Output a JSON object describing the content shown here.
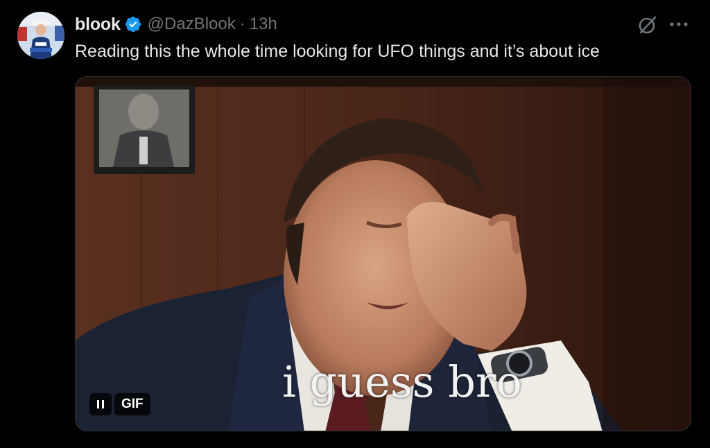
{
  "tweet": {
    "author_name": "blook",
    "handle": "@DazBlook",
    "separator": "·",
    "time": "13h",
    "text": "Reading this the whole time looking for UFO things and it’s about ice"
  },
  "media": {
    "caption": "i guess bro",
    "gif_label": "GIF"
  },
  "icons": {
    "verified": "verified-badge-icon",
    "grok": "grok-icon",
    "more": "more-options-icon",
    "pause": "pause-icon"
  },
  "colors": {
    "background": "#000000",
    "text_primary": "#e7e9ea",
    "text_secondary": "#71767b",
    "verified_blue": "#1d9bf0",
    "border": "#2f3336"
  }
}
